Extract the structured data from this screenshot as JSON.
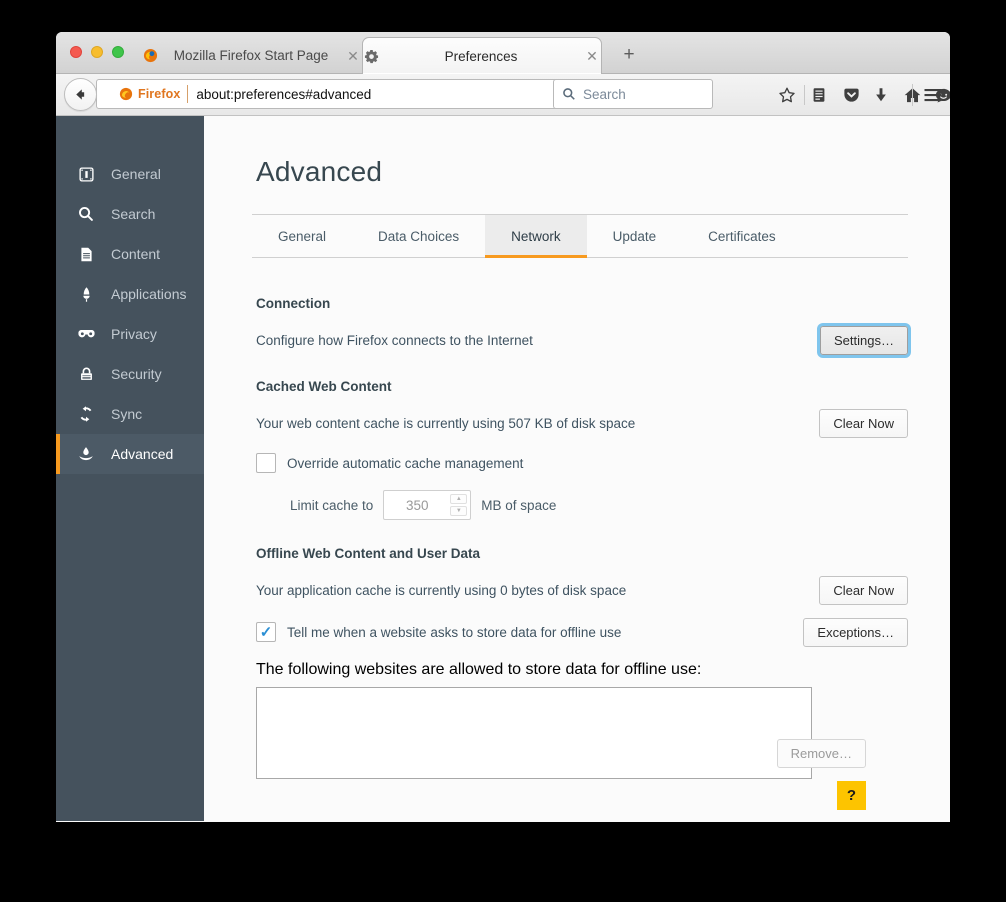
{
  "window": {
    "traffic_lights": [
      "close",
      "minimize",
      "maximize"
    ],
    "tabs": [
      {
        "title": "Mozilla Firefox Start Page",
        "favicon": "firefox-icon",
        "close": "✕",
        "selected": false
      },
      {
        "title": "Preferences",
        "favicon": "gear-icon",
        "close": "✕",
        "selected": true
      }
    ],
    "new_tab_label": "+"
  },
  "navbar": {
    "back_label": "←",
    "identity_label": "Firefox",
    "url": "about:preferences#advanced",
    "url_dropdown": "▼",
    "reload_label": "↻",
    "search_placeholder": "Search",
    "icons": [
      "bookmark-star-icon",
      "reader-list-icon",
      "pocket-icon",
      "downloads-icon",
      "home-icon",
      "hello-chat-icon",
      "hamburger-menu-icon"
    ]
  },
  "sidebar": {
    "items": [
      {
        "label": "General",
        "icon": "general-icon",
        "active": false
      },
      {
        "label": "Search",
        "icon": "search-icon",
        "active": false
      },
      {
        "label": "Content",
        "icon": "content-page-icon",
        "active": false
      },
      {
        "label": "Applications",
        "icon": "applications-icon",
        "active": false
      },
      {
        "label": "Privacy",
        "icon": "privacy-mask-icon",
        "active": false
      },
      {
        "label": "Security",
        "icon": "security-lock-icon",
        "active": false
      },
      {
        "label": "Sync",
        "icon": "sync-arrows-icon",
        "active": false
      },
      {
        "label": "Advanced",
        "icon": "advanced-icon",
        "active": true
      }
    ],
    "active_accent": "#f79a1f",
    "background": "#45525d"
  },
  "main": {
    "page_title": "Advanced",
    "tabs": [
      {
        "label": "General",
        "selected": false
      },
      {
        "label": "Data Choices",
        "selected": false
      },
      {
        "label": "Network",
        "selected": true
      },
      {
        "label": "Update",
        "selected": false
      },
      {
        "label": "Certificates",
        "selected": false
      }
    ],
    "connection": {
      "heading": "Connection",
      "description": "Configure how Firefox connects to the Internet",
      "settings_button": "Settings…",
      "settings_focused": true
    },
    "cached_web_content": {
      "heading": "Cached Web Content",
      "description": "Your web content cache is currently using 507 KB of disk space",
      "clear_button": "Clear Now",
      "override_checkbox": {
        "label": "Override automatic cache management",
        "checked": false
      },
      "limit_prefix": "Limit cache to",
      "limit_value": "350",
      "limit_suffix": "MB of space",
      "limit_enabled": false
    },
    "offline_web_content": {
      "heading": "Offline Web Content and User Data",
      "description": "Your application cache is currently using 0 bytes of disk space",
      "clear_button": "Clear Now",
      "notify_checkbox": {
        "label": "Tell me when a website asks to store data for offline use",
        "checked": true
      },
      "exceptions_button": "Exceptions…",
      "list_label": "The following websites are allowed to store data for offline use:",
      "list_items": [],
      "remove_button": "Remove…",
      "remove_disabled": true
    },
    "help_button": "?",
    "help_color": "#fdc400"
  }
}
